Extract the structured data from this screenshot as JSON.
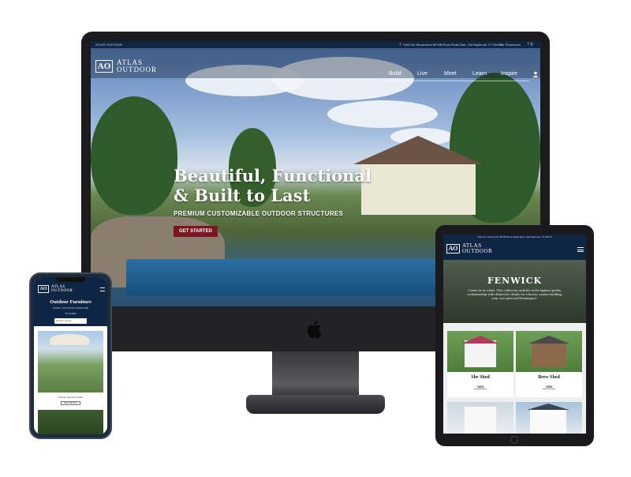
{
  "desktop": {
    "topbar": {
      "brand": "ATLAS OUTDOOR",
      "address": "📍 Visit Our Showroom! 69 Mill Rock Road East, Old Saybrook, CT 06475",
      "showroom_link": "Our Showroom",
      "social": "f ◎"
    },
    "logo": {
      "mark": "AO",
      "line1": "ATLAS",
      "line2": "OUTDOOR"
    },
    "nav": [
      "Build",
      "Live",
      "Meet",
      "Learn",
      "Inspire"
    ],
    "hero": {
      "headline_1": "Beautiful, Functional",
      "headline_2": "& Built to Last",
      "subheadline": "PREMIUM CUSTOMIZABLE OUTDOOR STRUCTURES",
      "cta": "GET STARTED"
    }
  },
  "tablet": {
    "topbar": "Visit Our Showroom! 69 Mill Rock Road East, Old Saybrook, CT 06475",
    "logo": {
      "mark": "AO",
      "line1": "ATLAS",
      "line2": "OUTDOOR"
    },
    "hero_title": "FENWICK",
    "hero_desc": "Create de la crème. This collection includes in the highest quality craftsmanship with distinctive details for a luxury custom building, your own personal Dreamspace.",
    "cards": [
      {
        "name": "She Shed",
        "view": "VIEW"
      },
      {
        "name": "Brew Shed",
        "view": "VIEW"
      }
    ]
  },
  "phone": {
    "logo": {
      "mark": "AO",
      "line1": "ATLAS",
      "line2": "OUTDOOR"
    },
    "page_title": "Outdoor Furniture",
    "breadcrumb": "HOME / OUTDOOR FURNITURE",
    "filter": "▼ FILTER",
    "sort": "Default sorting",
    "product_caption": "5 Piece Set with 4 Sofa",
    "view_label": "VIEW DETAILS"
  },
  "colors": {
    "navy": "#0e2543",
    "cta_red": "#7a1622"
  }
}
